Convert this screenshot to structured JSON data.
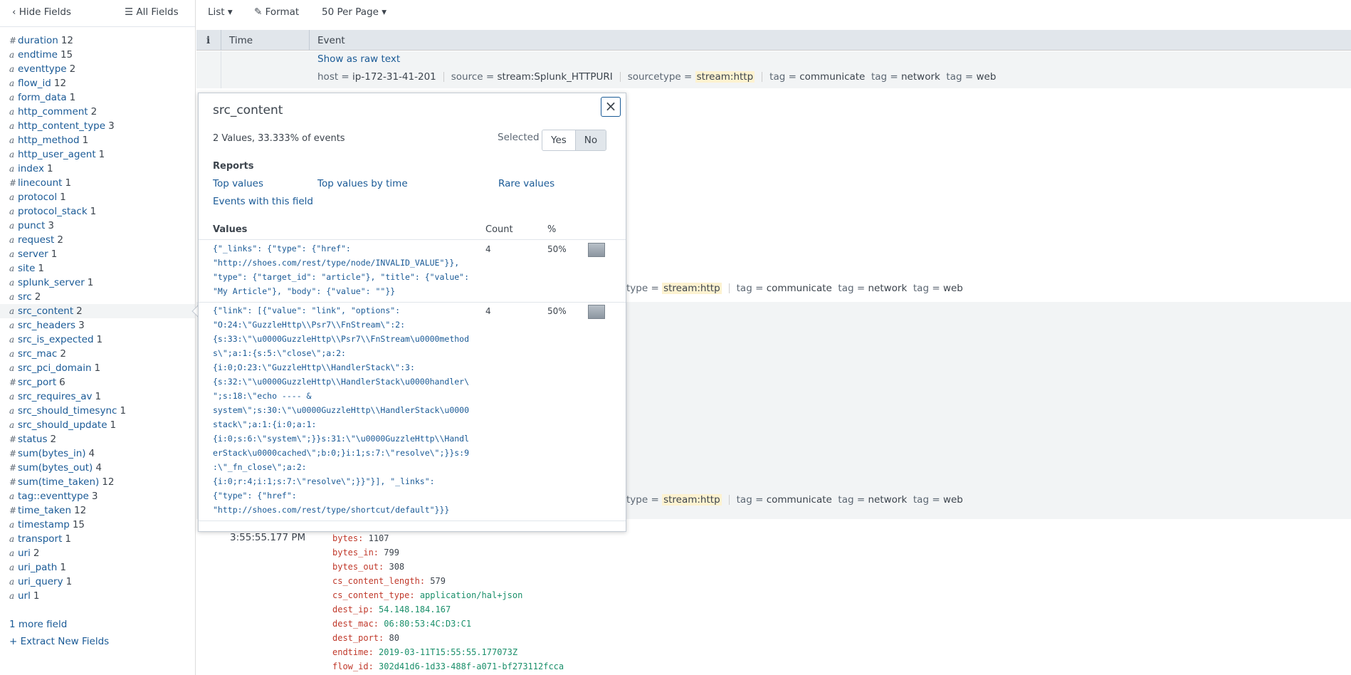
{
  "sidebar": {
    "hide_fields": "Hide Fields",
    "all_fields": "All Fields",
    "fields": [
      {
        "type": "#",
        "name": "duration",
        "count": "12"
      },
      {
        "type": "a",
        "name": "endtime",
        "count": "15"
      },
      {
        "type": "a",
        "name": "eventtype",
        "count": "2"
      },
      {
        "type": "a",
        "name": "flow_id",
        "count": "12"
      },
      {
        "type": "a",
        "name": "form_data",
        "count": "1"
      },
      {
        "type": "a",
        "name": "http_comment",
        "count": "2"
      },
      {
        "type": "a",
        "name": "http_content_type",
        "count": "3"
      },
      {
        "type": "a",
        "name": "http_method",
        "count": "1"
      },
      {
        "type": "a",
        "name": "http_user_agent",
        "count": "1"
      },
      {
        "type": "a",
        "name": "index",
        "count": "1"
      },
      {
        "type": "#",
        "name": "linecount",
        "count": "1"
      },
      {
        "type": "a",
        "name": "protocol",
        "count": "1"
      },
      {
        "type": "a",
        "name": "protocol_stack",
        "count": "1"
      },
      {
        "type": "a",
        "name": "punct",
        "count": "3"
      },
      {
        "type": "a",
        "name": "request",
        "count": "2"
      },
      {
        "type": "a",
        "name": "server",
        "count": "1"
      },
      {
        "type": "a",
        "name": "site",
        "count": "1"
      },
      {
        "type": "a",
        "name": "splunk_server",
        "count": "1"
      },
      {
        "type": "a",
        "name": "src",
        "count": "2"
      },
      {
        "type": "a",
        "name": "src_content",
        "count": "2"
      },
      {
        "type": "a",
        "name": "src_headers",
        "count": "3"
      },
      {
        "type": "a",
        "name": "src_is_expected",
        "count": "1"
      },
      {
        "type": "a",
        "name": "src_mac",
        "count": "2"
      },
      {
        "type": "a",
        "name": "src_pci_domain",
        "count": "1"
      },
      {
        "type": "#",
        "name": "src_port",
        "count": "6"
      },
      {
        "type": "a",
        "name": "src_requires_av",
        "count": "1"
      },
      {
        "type": "a",
        "name": "src_should_timesync",
        "count": "1"
      },
      {
        "type": "a",
        "name": "src_should_update",
        "count": "1"
      },
      {
        "type": "#",
        "name": "status",
        "count": "2"
      },
      {
        "type": "#",
        "name": "sum(bytes_in)",
        "count": "4"
      },
      {
        "type": "#",
        "name": "sum(bytes_out)",
        "count": "4"
      },
      {
        "type": "#",
        "name": "sum(time_taken)",
        "count": "12"
      },
      {
        "type": "a",
        "name": "tag::eventtype",
        "count": "3"
      },
      {
        "type": "#",
        "name": "time_taken",
        "count": "12"
      },
      {
        "type": "a",
        "name": "timestamp",
        "count": "15"
      },
      {
        "type": "a",
        "name": "transport",
        "count": "1"
      },
      {
        "type": "a",
        "name": "uri",
        "count": "2"
      },
      {
        "type": "a",
        "name": "uri_path",
        "count": "1"
      },
      {
        "type": "a",
        "name": "uri_query",
        "count": "1"
      },
      {
        "type": "a",
        "name": "url",
        "count": "1"
      }
    ],
    "more_field": "1 more field",
    "extract_new": "+ Extract New Fields"
  },
  "toolbar": {
    "list": "List",
    "format": "Format",
    "per_page": "50 Per Page"
  },
  "table": {
    "info_col": "i",
    "time_col": "Time",
    "event_col": "Event"
  },
  "event1": {
    "show_raw": "Show as raw text",
    "host_k": "host =",
    "host_v": "ip-172-31-41-201",
    "source_k": "source =",
    "source_v": "stream:Splunk_HTTPURI",
    "sourcetype_k": "sourcetype =",
    "sourcetype_v": "stream:http",
    "tag_k": "tag =",
    "tag1": "communicate",
    "tag2": "network",
    "tag3": "web"
  },
  "event_partial": {
    "sourcetype_k": "type =",
    "sourcetype_v": "stream:http",
    "tag_k": "tag =",
    "tag1": "communicate",
    "tag2": "network",
    "tag3": "web"
  },
  "event4": {
    "time": "3:55:55.177 PM",
    "fields": [
      {
        "k": "bytes:",
        "v": "1107",
        "green": false
      },
      {
        "k": "bytes_in:",
        "v": "799",
        "green": false
      },
      {
        "k": "bytes_out:",
        "v": "308",
        "green": false
      },
      {
        "k": "cs_content_length:",
        "v": "579",
        "green": false
      },
      {
        "k": "cs_content_type:",
        "v": "application/hal+json",
        "green": true
      },
      {
        "k": "dest_ip:",
        "v": "54.148.184.167",
        "green": true
      },
      {
        "k": "dest_mac:",
        "v": "06:80:53:4C:D3:C1",
        "green": true
      },
      {
        "k": "dest_port:",
        "v": "80",
        "green": false
      },
      {
        "k": "endtime:",
        "v": "2019-03-11T15:55:55.177073Z",
        "green": true
      },
      {
        "k": "flow_id:",
        "v": "302d41d6-1d33-488f-a071-bf273112fcca",
        "green": true
      }
    ]
  },
  "popup": {
    "title": "src_content",
    "summary": "2 Values, 33.333% of events",
    "selected_label": "Selected",
    "yes": "Yes",
    "no": "No",
    "reports_heading": "Reports",
    "top_values": "Top values",
    "top_values_by_time": "Top values by time",
    "rare_values": "Rare values",
    "events_with_field": "Events with this field",
    "values_heading": "Values",
    "count_heading": "Count",
    "pct_heading": "%",
    "values": [
      {
        "text": "{\"_links\": {\"type\": {\"href\":\n\"http://shoes.com/rest/type/node/INVALID_VALUE\"}},\n\"type\": {\"target_id\": \"article\"}, \"title\": {\"value\":\n\"My Article\"}, \"body\": {\"value\": \"\"}}",
        "count": "4",
        "pct": "50%",
        "fraction": 0.5
      },
      {
        "text": "{\"link\": [{\"value\": \"link\", \"options\":\n\"O:24:\\\"GuzzleHttp\\\\Psr7\\\\FnStream\\\":2:\n{s:33:\\\"\\u0000GuzzleHttp\\\\Psr7\\\\FnStream\\u0000method\ns\\\";a:1:{s:5:\\\"close\\\";a:2:\n{i:0;O:23:\\\"GuzzleHttp\\\\HandlerStack\\\":3:\n{s:32:\\\"\\u0000GuzzleHttp\\\\HandlerStack\\u0000handler\\\n\";s:18:\\\"echo ---- &\nsystem\\\";s:30:\\\"\\u0000GuzzleHttp\\\\HandlerStack\\u0000\nstack\\\";a:1:{i:0;a:1:\n{i:0;s:6:\\\"system\\\";}}s:31:\\\"\\u0000GuzzleHttp\\\\Handl\nerStack\\u0000cached\\\";b:0;}i:1;s:7:\\\"resolve\\\";}}s:9\n:\\\"_fn_close\\\";a:2:\n{i:0;r:4;i:1;s:7:\\\"resolve\\\";}}\"}], \"_links\":\n{\"type\": {\"href\":\n\"http://shoes.com/rest/type/shortcut/default\"}}}",
        "count": "4",
        "pct": "50%",
        "fraction": 0.5
      }
    ]
  }
}
